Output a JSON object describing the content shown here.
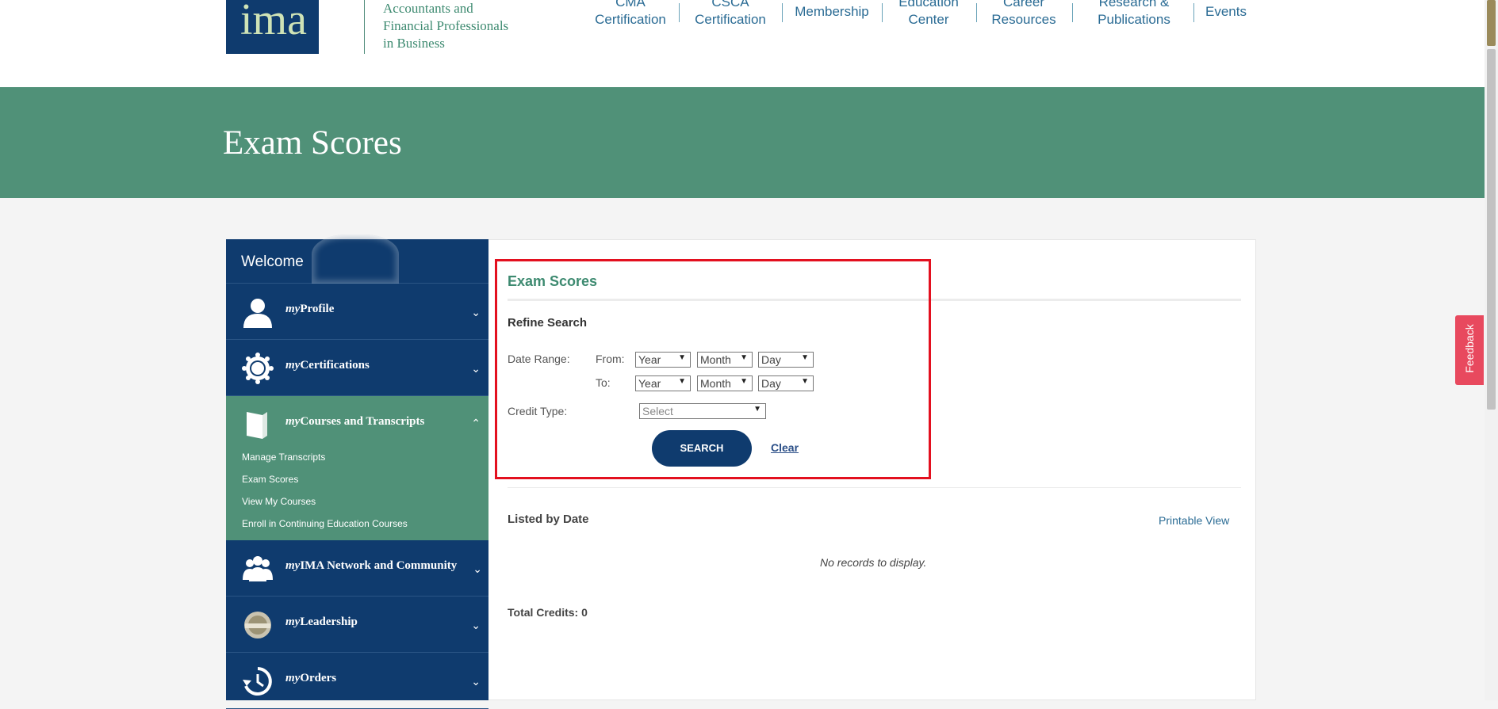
{
  "header": {
    "logo_text": "ima",
    "logo_reg": "®",
    "tagline": [
      "Accountants and",
      "Financial Professionals",
      "in Business"
    ],
    "nav": [
      {
        "label": "CMA\nCertification"
      },
      {
        "label": "CSCA\nCertification"
      },
      {
        "label": "Membership"
      },
      {
        "label": "Education\nCenter"
      },
      {
        "label": "Career\nResources"
      },
      {
        "label": "Research &\nPublications"
      },
      {
        "label": "Events"
      }
    ]
  },
  "banner": {
    "title": "Exam Scores"
  },
  "sidebar": {
    "welcome": "Welcome",
    "items": [
      {
        "prefix": "my",
        "label": "Profile",
        "icon": "user-icon",
        "chevron": "⌄"
      },
      {
        "prefix": "my",
        "label": "Certifications",
        "icon": "certification-seal-icon",
        "chevron": "⌄"
      },
      {
        "prefix": "my",
        "label": "Courses and Transcripts",
        "icon": "book-icon",
        "chevron": "⌃"
      },
      {
        "prefix": "my",
        "label": "IMA Network and Community",
        "icon": "people-icon",
        "chevron": "⌄"
      },
      {
        "prefix": "my",
        "label": "Leadership",
        "icon": "leadership-badge-icon",
        "chevron": "⌄"
      },
      {
        "prefix": "my",
        "label": "Orders",
        "icon": "history-icon",
        "chevron": "⌄"
      }
    ],
    "sub_links": [
      "Manage Transcripts",
      "Exam Scores",
      "View My Courses",
      "Enroll in Continuing Education Courses"
    ]
  },
  "main": {
    "title": "Exam Scores",
    "refine": "Refine Search",
    "date_range_label": "Date Range:",
    "from_label": "From:",
    "to_label": "To:",
    "year": "Year",
    "month": "Month",
    "day": "Day",
    "credit_type_label": "Credit Type:",
    "credit_type_value": "Select",
    "search_button": "SEARCH",
    "clear_link": "Clear",
    "listed_by": "Listed by Date",
    "printable": "Printable View",
    "no_records": "No records to display.",
    "total_credits": "Total Credits: 0"
  },
  "feedback": "Feedback",
  "colors": {
    "navy": "#0f3b6e",
    "green": "#509178",
    "highlight": "#e3101f",
    "feedback": "#e8495e"
  }
}
